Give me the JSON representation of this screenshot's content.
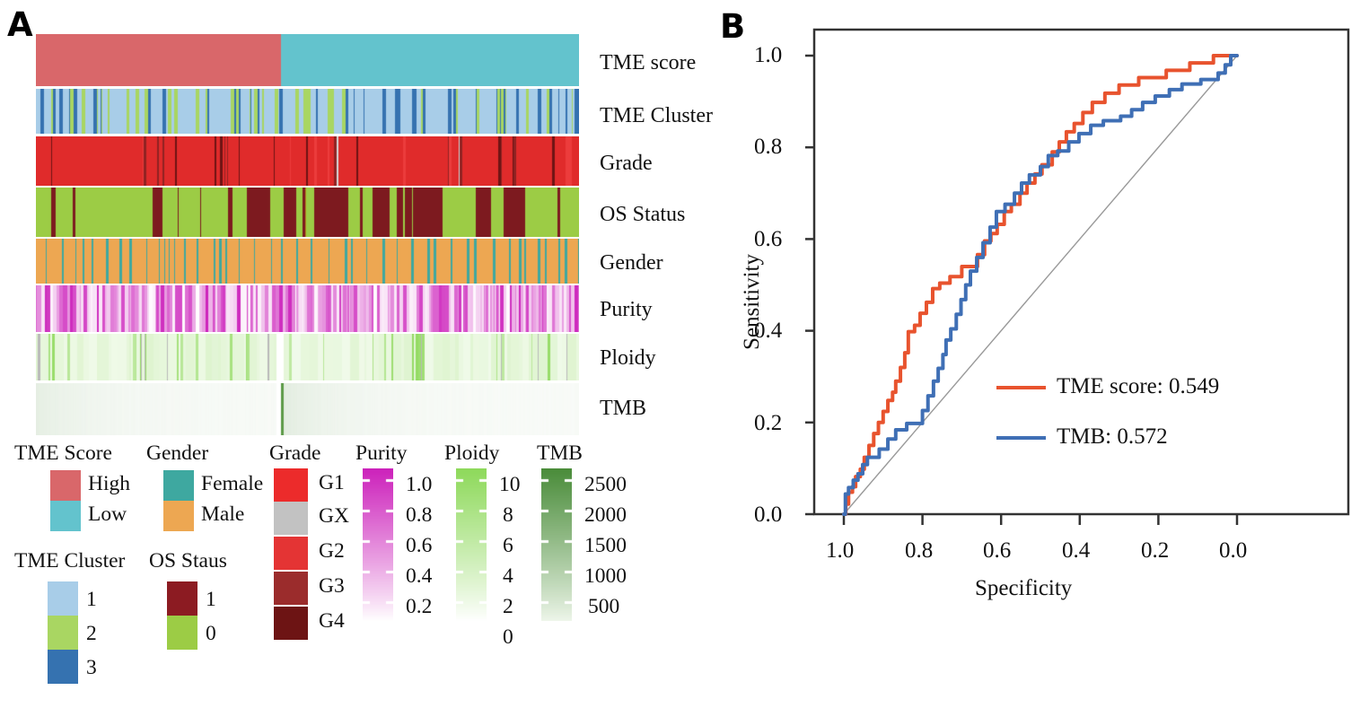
{
  "figure": {
    "panels": [
      {
        "letter": "A"
      },
      {
        "letter": "B"
      }
    ]
  },
  "panelA": {
    "letter": "A",
    "rows": [
      {
        "label": "TME score",
        "track": "tme_score"
      },
      {
        "label": "TME Cluster",
        "track": "tme_cluster"
      },
      {
        "label": "Grade",
        "track": "grade"
      },
      {
        "label": "OS Status",
        "track": "os_status"
      },
      {
        "label": "Gender",
        "track": "gender"
      },
      {
        "label": "Purity",
        "track": "purity"
      },
      {
        "label": "Ploidy",
        "track": "ploidy"
      },
      {
        "label": "TMB",
        "track": "tmb"
      }
    ],
    "legends": {
      "tme_score": {
        "title": "TME Score",
        "items": [
          {
            "label": "High",
            "color": "#d9676a"
          },
          {
            "label": "Low",
            "color": "#63c3cd"
          }
        ]
      },
      "gender": {
        "title": "Gender",
        "items": [
          {
            "label": "Female",
            "color": "#3ea8a0"
          },
          {
            "label": "Male",
            "color": "#eda champion"
          }
        ]
      },
      "gender_fixed": {
        "title": "Gender",
        "items": [
          {
            "label": "Female",
            "color": "#3ea8a0"
          },
          {
            "label": "Male",
            "color": "#eda752"
          }
        ]
      },
      "tme_cluster": {
        "title": "TME Cluster",
        "items": [
          {
            "label": "1",
            "color": "#a8cde8"
          },
          {
            "label": "2",
            "color": "#a9d662"
          },
          {
            "label": "3",
            "color": "#3572b0"
          }
        ]
      },
      "os_status": {
        "title": "OS Staus",
        "items": [
          {
            "label": "1",
            "color": "#8c1b22"
          },
          {
            "label": "0",
            "color": "#9ccc45"
          }
        ]
      },
      "grade": {
        "title": "Grade",
        "items": [
          {
            "label": "G1",
            "color": "#ec2b2b"
          },
          {
            "label": "GX",
            "color": "#c2c2c2"
          },
          {
            "label": "G2",
            "color": "#e43434"
          },
          {
            "label": "G3",
            "color": "#9b2c2c"
          },
          {
            "label": "G4",
            "color": "#6d1414"
          }
        ]
      },
      "purity": {
        "title": "Purity",
        "ticks": [
          "1.0",
          "0.8",
          "0.6",
          "0.4",
          "0.2"
        ],
        "color_high": "#cc22bb",
        "color_low": "#ffffff"
      },
      "ploidy": {
        "title": "Ploidy",
        "ticks": [
          "10",
          "8",
          "6",
          "4",
          "2",
          "0"
        ],
        "color_high": "#8ed95b",
        "color_low": "#ffffff"
      },
      "tmb": {
        "title": "TMB",
        "ticks": [
          "2500",
          "2000",
          "1500",
          "1000",
          "500"
        ],
        "color_high": "#4a8c3a",
        "color_low": "#eef6ea"
      }
    }
  },
  "panelB": {
    "letter": "B",
    "chart_data": {
      "type": "line",
      "title": "",
      "xlabel": "Specificity",
      "ylabel": "Sensitivity",
      "xticks": [
        "1.0",
        "0.8",
        "0.6",
        "0.4",
        "0.2",
        "0.0"
      ],
      "yticks": [
        "1.0",
        "0.8",
        "0.6",
        "0.4",
        "0.2",
        "0.0"
      ],
      "xlim": [
        1.0,
        0.0
      ],
      "ylim": [
        0.0,
        1.0
      ],
      "x_axis_reversed": true,
      "grid": false,
      "legend_position": "inside-lower-right",
      "reference_line": {
        "name": "chance",
        "color": "#999999",
        "from": [
          1.0,
          0.0
        ],
        "to": [
          0.0,
          1.0
        ]
      },
      "series": [
        {
          "name": "TME score",
          "auc": 0.549,
          "legend_label": "TME score: 0.549",
          "color": "#e8532e",
          "points": [
            [
              1.0,
              0.0
            ],
            [
              0.995,
              0.0
            ],
            [
              0.995,
              0.022
            ],
            [
              0.988,
              0.022
            ],
            [
              0.988,
              0.048
            ],
            [
              0.978,
              0.048
            ],
            [
              0.978,
              0.06
            ],
            [
              0.97,
              0.06
            ],
            [
              0.97,
              0.082
            ],
            [
              0.958,
              0.082
            ],
            [
              0.958,
              0.098
            ],
            [
              0.948,
              0.098
            ],
            [
              0.948,
              0.124
            ],
            [
              0.936,
              0.124
            ],
            [
              0.936,
              0.15
            ],
            [
              0.924,
              0.15
            ],
            [
              0.924,
              0.176
            ],
            [
              0.912,
              0.176
            ],
            [
              0.912,
              0.2
            ],
            [
              0.9,
              0.2
            ],
            [
              0.9,
              0.224
            ],
            [
              0.888,
              0.224
            ],
            [
              0.888,
              0.248
            ],
            [
              0.876,
              0.248
            ],
            [
              0.876,
              0.266
            ],
            [
              0.868,
              0.266
            ],
            [
              0.868,
              0.29
            ],
            [
              0.856,
              0.29
            ],
            [
              0.856,
              0.32
            ],
            [
              0.845,
              0.32
            ],
            [
              0.845,
              0.352
            ],
            [
              0.836,
              0.352
            ],
            [
              0.836,
              0.398
            ],
            [
              0.82,
              0.398
            ],
            [
              0.82,
              0.412
            ],
            [
              0.806,
              0.412
            ],
            [
              0.806,
              0.438
            ],
            [
              0.79,
              0.438
            ],
            [
              0.79,
              0.462
            ],
            [
              0.774,
              0.462
            ],
            [
              0.774,
              0.492
            ],
            [
              0.756,
              0.492
            ],
            [
              0.756,
              0.504
            ],
            [
              0.73,
              0.504
            ],
            [
              0.73,
              0.518
            ],
            [
              0.7,
              0.518
            ],
            [
              0.7,
              0.54
            ],
            [
              0.66,
              0.54
            ],
            [
              0.66,
              0.566
            ],
            [
              0.642,
              0.566
            ],
            [
              0.642,
              0.596
            ],
            [
              0.626,
              0.596
            ],
            [
              0.626,
              0.612
            ],
            [
              0.61,
              0.612
            ],
            [
              0.61,
              0.632
            ],
            [
              0.592,
              0.632
            ],
            [
              0.592,
              0.66
            ],
            [
              0.574,
              0.66
            ],
            [
              0.574,
              0.676
            ],
            [
              0.552,
              0.676
            ],
            [
              0.552,
              0.7
            ],
            [
              0.534,
              0.7
            ],
            [
              0.534,
              0.722
            ],
            [
              0.514,
              0.722
            ],
            [
              0.514,
              0.742
            ],
            [
              0.496,
              0.742
            ],
            [
              0.496,
              0.762
            ],
            [
              0.47,
              0.762
            ],
            [
              0.47,
              0.79
            ],
            [
              0.452,
              0.79
            ],
            [
              0.452,
              0.812
            ],
            [
              0.434,
              0.812
            ],
            [
              0.434,
              0.834
            ],
            [
              0.414,
              0.834
            ],
            [
              0.414,
              0.852
            ],
            [
              0.392,
              0.852
            ],
            [
              0.392,
              0.876
            ],
            [
              0.368,
              0.876
            ],
            [
              0.368,
              0.898
            ],
            [
              0.336,
              0.898
            ],
            [
              0.336,
              0.918
            ],
            [
              0.3,
              0.918
            ],
            [
              0.3,
              0.936
            ],
            [
              0.25,
              0.936
            ],
            [
              0.25,
              0.952
            ],
            [
              0.18,
              0.952
            ],
            [
              0.18,
              0.968
            ],
            [
              0.12,
              0.968
            ],
            [
              0.12,
              0.984
            ],
            [
              0.06,
              0.984
            ],
            [
              0.06,
              1.0
            ],
            [
              0.0,
              1.0
            ]
          ]
        },
        {
          "name": "TMB",
          "auc": 0.572,
          "legend_label": "TMB: 0.572",
          "color": "#3f6fb5",
          "points": [
            [
              1.0,
              0.0
            ],
            [
              0.996,
              0.0
            ],
            [
              0.996,
              0.044
            ],
            [
              0.988,
              0.044
            ],
            [
              0.988,
              0.058
            ],
            [
              0.976,
              0.058
            ],
            [
              0.976,
              0.074
            ],
            [
              0.964,
              0.074
            ],
            [
              0.964,
              0.088
            ],
            [
              0.952,
              0.088
            ],
            [
              0.952,
              0.108
            ],
            [
              0.94,
              0.108
            ],
            [
              0.94,
              0.124
            ],
            [
              0.91,
              0.124
            ],
            [
              0.91,
              0.142
            ],
            [
              0.888,
              0.142
            ],
            [
              0.888,
              0.164
            ],
            [
              0.868,
              0.164
            ],
            [
              0.868,
              0.184
            ],
            [
              0.84,
              0.184
            ],
            [
              0.84,
              0.198
            ],
            [
              0.8,
              0.198
            ],
            [
              0.8,
              0.226
            ],
            [
              0.786,
              0.226
            ],
            [
              0.786,
              0.258
            ],
            [
              0.772,
              0.258
            ],
            [
              0.772,
              0.29
            ],
            [
              0.76,
              0.29
            ],
            [
              0.76,
              0.318
            ],
            [
              0.748,
              0.318
            ],
            [
              0.748,
              0.348
            ],
            [
              0.74,
              0.348
            ],
            [
              0.74,
              0.38
            ],
            [
              0.728,
              0.38
            ],
            [
              0.728,
              0.404
            ],
            [
              0.714,
              0.404
            ],
            [
              0.714,
              0.436
            ],
            [
              0.702,
              0.436
            ],
            [
              0.702,
              0.468
            ],
            [
              0.69,
              0.468
            ],
            [
              0.69,
              0.5
            ],
            [
              0.678,
              0.5
            ],
            [
              0.678,
              0.53
            ],
            [
              0.662,
              0.53
            ],
            [
              0.662,
              0.56
            ],
            [
              0.646,
              0.56
            ],
            [
              0.646,
              0.592
            ],
            [
              0.628,
              0.592
            ],
            [
              0.628,
              0.626
            ],
            [
              0.612,
              0.626
            ],
            [
              0.612,
              0.66
            ],
            [
              0.59,
              0.66
            ],
            [
              0.59,
              0.676
            ],
            [
              0.566,
              0.676
            ],
            [
              0.566,
              0.7
            ],
            [
              0.548,
              0.7
            ],
            [
              0.548,
              0.722
            ],
            [
              0.528,
              0.722
            ],
            [
              0.528,
              0.74
            ],
            [
              0.5,
              0.74
            ],
            [
              0.5,
              0.758
            ],
            [
              0.48,
              0.758
            ],
            [
              0.48,
              0.782
            ],
            [
              0.456,
              0.782
            ],
            [
              0.456,
              0.792
            ],
            [
              0.428,
              0.792
            ],
            [
              0.428,
              0.812
            ],
            [
              0.402,
              0.812
            ],
            [
              0.402,
              0.83
            ],
            [
              0.372,
              0.83
            ],
            [
              0.372,
              0.848
            ],
            [
              0.34,
              0.848
            ],
            [
              0.34,
              0.858
            ],
            [
              0.296,
              0.858
            ],
            [
              0.296,
              0.868
            ],
            [
              0.268,
              0.868
            ],
            [
              0.268,
              0.882
            ],
            [
              0.24,
              0.882
            ],
            [
              0.24,
              0.898
            ],
            [
              0.208,
              0.898
            ],
            [
              0.208,
              0.912
            ],
            [
              0.172,
              0.912
            ],
            [
              0.172,
              0.926
            ],
            [
              0.14,
              0.926
            ],
            [
              0.14,
              0.938
            ],
            [
              0.092,
              0.938
            ],
            [
              0.092,
              0.948
            ],
            [
              0.048,
              0.948
            ],
            [
              0.048,
              0.962
            ],
            [
              0.03,
              0.962
            ],
            [
              0.03,
              0.98
            ],
            [
              0.016,
              0.98
            ],
            [
              0.016,
              1.0
            ],
            [
              0.0,
              1.0
            ]
          ]
        }
      ]
    }
  }
}
